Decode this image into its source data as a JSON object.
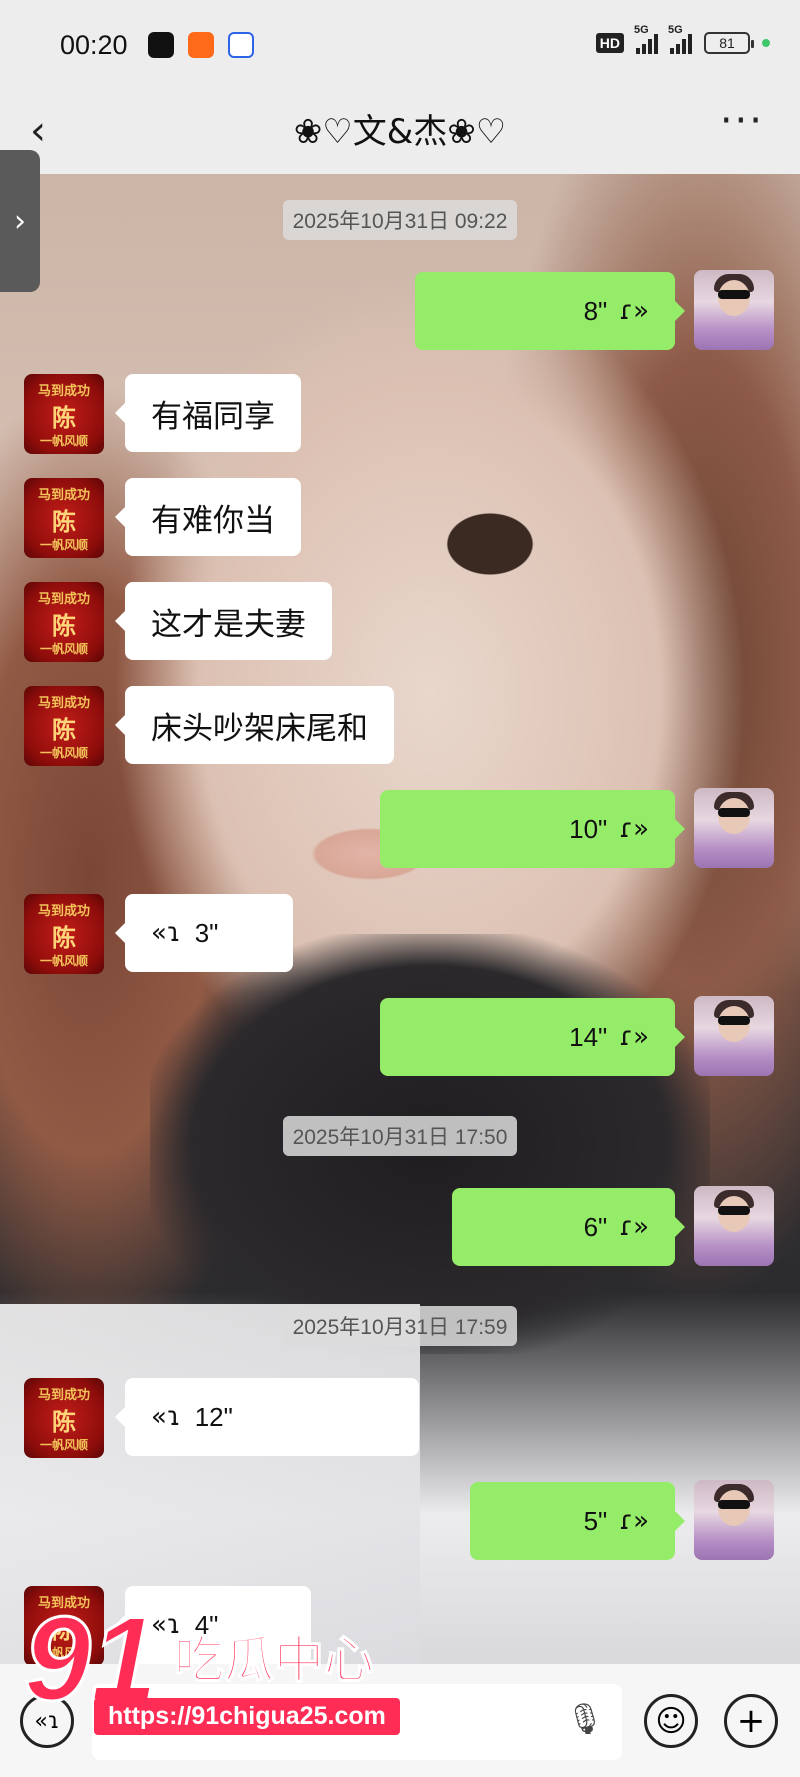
{
  "status_bar": {
    "time": "00:20",
    "apps": [
      "tiktok-icon",
      "kuaishou-icon",
      "baidu-icon"
    ],
    "hd_label": "HD",
    "sig1_label": "5G",
    "sig2_label": "5G",
    "battery": "81"
  },
  "header": {
    "title": "❀♡文&杰❀♡",
    "back_icon": "back-icon",
    "more_label": "···"
  },
  "chat": {
    "timestamps": [
      "2025年10月31日 09:22",
      "2025年10月31日 17:50",
      "2025年10月31日 17:59"
    ],
    "messages": [
      {
        "side": "out",
        "type": "voice",
        "text": "8\""
      },
      {
        "side": "in",
        "type": "text",
        "text": "有福同享"
      },
      {
        "side": "in",
        "type": "text",
        "text": "有难你当"
      },
      {
        "side": "in",
        "type": "text",
        "text": "这才是夫妻"
      },
      {
        "side": "in",
        "type": "text",
        "text": "床头吵架床尾和"
      },
      {
        "side": "out",
        "type": "voice",
        "text": "10\""
      },
      {
        "side": "in",
        "type": "voice",
        "text": "3\""
      },
      {
        "side": "out",
        "type": "voice",
        "text": "14\""
      },
      {
        "side": "out",
        "type": "voice",
        "text": "6\""
      },
      {
        "side": "in",
        "type": "voice",
        "text": "12\""
      },
      {
        "side": "out",
        "type": "voice",
        "text": "5\""
      },
      {
        "side": "in",
        "type": "voice",
        "text": "4\""
      }
    ],
    "avatar_badge": {
      "line1": "马到成功",
      "line2": "陈",
      "line3": "一帆风顺"
    }
  },
  "watermark": {
    "number": "91",
    "text": "吃瓜中心",
    "url": "https://91chigua25.com"
  }
}
